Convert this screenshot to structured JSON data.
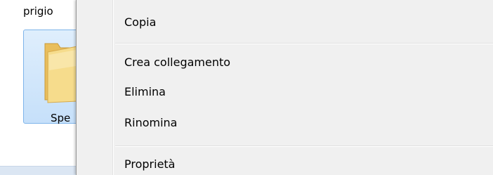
{
  "explorer": {
    "top_item_label": "prigio",
    "selected_item_label": "Spe"
  },
  "context_menu": {
    "items": [
      {
        "label": "Copia"
      },
      {
        "label": "Crea collegamento"
      },
      {
        "label": "Elimina"
      },
      {
        "label": "Rinomina"
      },
      {
        "label": "Proprietà"
      }
    ]
  },
  "icons": {
    "folder": "folder-icon"
  },
  "colors": {
    "menu_background": "#f0f0f0",
    "selection_fill": "#cce4fb",
    "selection_border": "#7eb4ea",
    "folder_yellow": "#f3d27c"
  }
}
